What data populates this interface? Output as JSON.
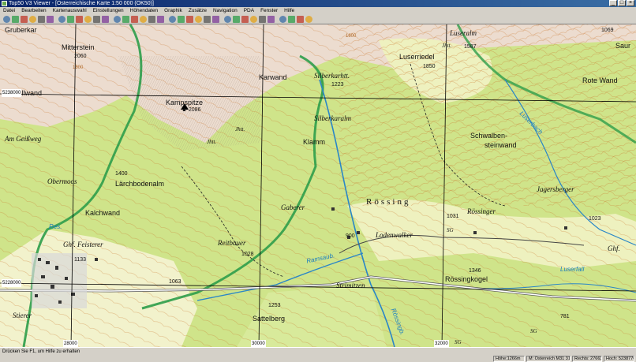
{
  "window": {
    "title": "Top50 V3 Viewer - [Österreichische Karte 1:50 000 (ÖK50)]",
    "controls": [
      "_",
      "□",
      "×"
    ]
  },
  "menu": [
    "Datei",
    "Bearbeiten",
    "Kartenauswahl",
    "Einstellungen",
    "Höhendaten",
    "Graphik",
    "Zusätze",
    "Navigation",
    "PDA",
    "Fenster",
    "Hilfe"
  ],
  "toolbar_icons": [
    "hand-icon",
    "zoom-in-icon",
    "zoom-out-icon",
    "zoom-fit-icon",
    "zoom-area-icon",
    "zoom-prev-icon",
    "print-icon",
    "export-icon",
    "copy-icon",
    "search-icon",
    "grid-icon",
    "layers-icon",
    "target-icon",
    "arrow-icon",
    "line-icon",
    "profile-icon",
    "undo-icon",
    "redo-icon",
    "point-icon",
    "route-icon",
    "track-icon",
    "flag-icon",
    "pda-icon",
    "gps-icon",
    "waypoint-icon",
    "measure-icon",
    "area-icon",
    "circle-icon",
    "text-icon",
    "symbol-icon",
    "color-icon",
    "settings-icon",
    "help-icon",
    "info-icon"
  ],
  "map": {
    "labels": {
      "gruberkar": "Gruberkar",
      "mitterstein": "Mitterstein",
      "mitterstein_elev": "2060",
      "stellwand": "Stellwand",
      "kampspitze": "Kampspitze",
      "kampspitze_elev": "▲ 2086",
      "karwand": "Karwand",
      "silberkarhtt": "Silberkarhtt.",
      "silberkarhtt_elev": "1223",
      "silberkaralm": "Silberkaralm",
      "luseralm": "Luseralm",
      "luseralm_hut": "Jhtt.",
      "luseralm_elev": "1587",
      "luserriedel": "Luserriedel",
      "luserriedel_elev": "1850",
      "rote_wand": "Rote Wand",
      "saur": "Saur",
      "elev_1069": "1069",
      "am_geissweg": "Am Geißweg",
      "jhtt1": "Jhtt.",
      "jhtt2": "Jhtt.",
      "klamm": "Klamm",
      "schwalbensteinwand1": "Schwalben-",
      "schwalbensteinwand2": "steinwand",
      "luserbach": "Luserbach",
      "elev_1400": "1400",
      "obermoos": "Obermoos",
      "larchbodenalm": "Lärchbodenalm",
      "jagersberger": "Jagersberger",
      "kalchwand": "Kalchwand",
      "gaberer": "Gaberer",
      "rossing": "Rössing",
      "rossinger": "Rössinger",
      "elev_1031": "1031",
      "elev_1023": "1023",
      "res": "Res.",
      "ghf_feisterer": "Ghf. Feisterer",
      "reitbauer": "Reitbauer",
      "elev_1028": "1028",
      "elev_900": "900",
      "lodenwalker": "Lodenwalker",
      "sg1": "SG",
      "ghf_right": "Ghf.",
      "elev_1133": "1133",
      "ramsaubach": "Ramsaub.",
      "elev_1346": "1346",
      "rossingkogel": "Rössingkogel",
      "luserfall": "Luserfall",
      "elev_1063": "1063",
      "strimitzen": "Strimitzen",
      "elev_1253": "1253",
      "sattelberg": "Sattelberg",
      "elev_781": "781",
      "rossingbach": "Rössingb.",
      "sg2": "SG",
      "sg3": "SG",
      "stierer": "Stierer",
      "elev_1600": "1600",
      "elev_1800": "1800"
    },
    "grid_labels": {
      "y_top": "5238000",
      "y_bottom": "5228000",
      "x_left": "28000",
      "x_mid": "30000",
      "x_right": "32000"
    }
  },
  "status": {
    "hint": "Drücken Sie F1, um Hilfe zu erhalten",
    "panels": [
      "Höhe:1266m",
      "M: Österreich  M31  31",
      "Rechts: 27663",
      "Hoch: 5238776"
    ]
  },
  "colors": {
    "forest": "#c8e07e",
    "meadow": "#f0f0c8",
    "rock": "#e9d6c8",
    "contour": "#c9762d",
    "border_green": "#2e9d4a",
    "water": "#2a86c7",
    "road": "#ffffff",
    "titlebar": "#0a246a"
  }
}
